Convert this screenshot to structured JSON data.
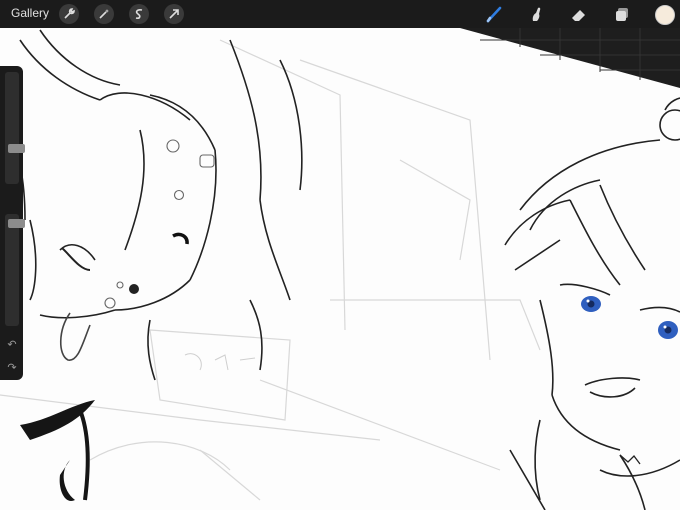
{
  "topbar": {
    "gallery_label": "Gallery",
    "left_tools": [
      {
        "name": "actions",
        "icon": "wrench-icon"
      },
      {
        "name": "adjustments",
        "icon": "magic-wand-icon"
      },
      {
        "name": "selection",
        "icon": "selection-s-icon"
      },
      {
        "name": "transform",
        "icon": "arrow-cursor-icon"
      }
    ],
    "right_tools": [
      {
        "name": "brush",
        "icon": "brush-icon",
        "active": true
      },
      {
        "name": "smudge",
        "icon": "smudge-icon"
      },
      {
        "name": "eraser",
        "icon": "eraser-icon"
      },
      {
        "name": "layers",
        "icon": "layers-icon"
      }
    ],
    "active_tool_color": "#2f7de1",
    "current_color": "#f6ebdc"
  },
  "sidebar": {
    "brush_size_level": 0.3,
    "opacity_level": 0.05,
    "modify_icon": "square-icon",
    "undo_icon": "undo-arrow-icon",
    "redo_icon": "redo-arrow-icon"
  },
  "canvas": {
    "content": "line-art-sketch",
    "eye_color": "#2f5fbf"
  }
}
